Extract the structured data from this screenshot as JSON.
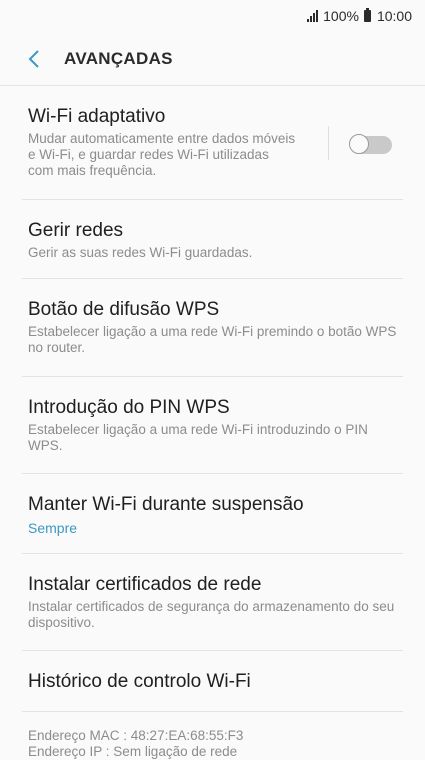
{
  "status_bar": {
    "battery": "100%",
    "time": "10:00",
    "icons": [
      "signal-icon",
      "battery-icon"
    ]
  },
  "header": {
    "back_icon": "chevron-left-icon",
    "title": "AVANÇADAS"
  },
  "settings": {
    "wifi_adaptive": {
      "title": "Wi-Fi adaptativo",
      "description": "Mudar automaticamente entre dados móveis e Wi-Fi, e guardar redes Wi-Fi utilizadas com mais frequência.",
      "toggle_on": false
    },
    "manage_networks": {
      "title": "Gerir redes",
      "description": "Gerir as suas redes Wi-Fi guardadas."
    },
    "wps_button": {
      "title": "Botão de difusão WPS",
      "description": "Estabelecer ligação a uma rede Wi-Fi premindo o botão WPS no router."
    },
    "wps_pin": {
      "title": "Introdução do PIN WPS",
      "description": "Estabelecer ligação a uma rede Wi-Fi introduzindo o PIN WPS."
    },
    "keep_wifi": {
      "title": "Manter Wi-Fi durante suspensão",
      "value": "Sempre"
    },
    "install_certs": {
      "title": "Instalar certificados de rede",
      "description": "Instalar certificados de segurança do armazenamento do seu dispositivo."
    },
    "wifi_history": {
      "title": "Histórico de controlo Wi-Fi"
    }
  },
  "footer": {
    "mac_address": "Endereço MAC : 48:27:EA:68:55:F3",
    "ip_address": "Endereço IP : Sem ligação de rede"
  },
  "colors": {
    "accent": "#3b99c2",
    "background": "#fafafa",
    "secondary_text": "#8c8c8c"
  }
}
